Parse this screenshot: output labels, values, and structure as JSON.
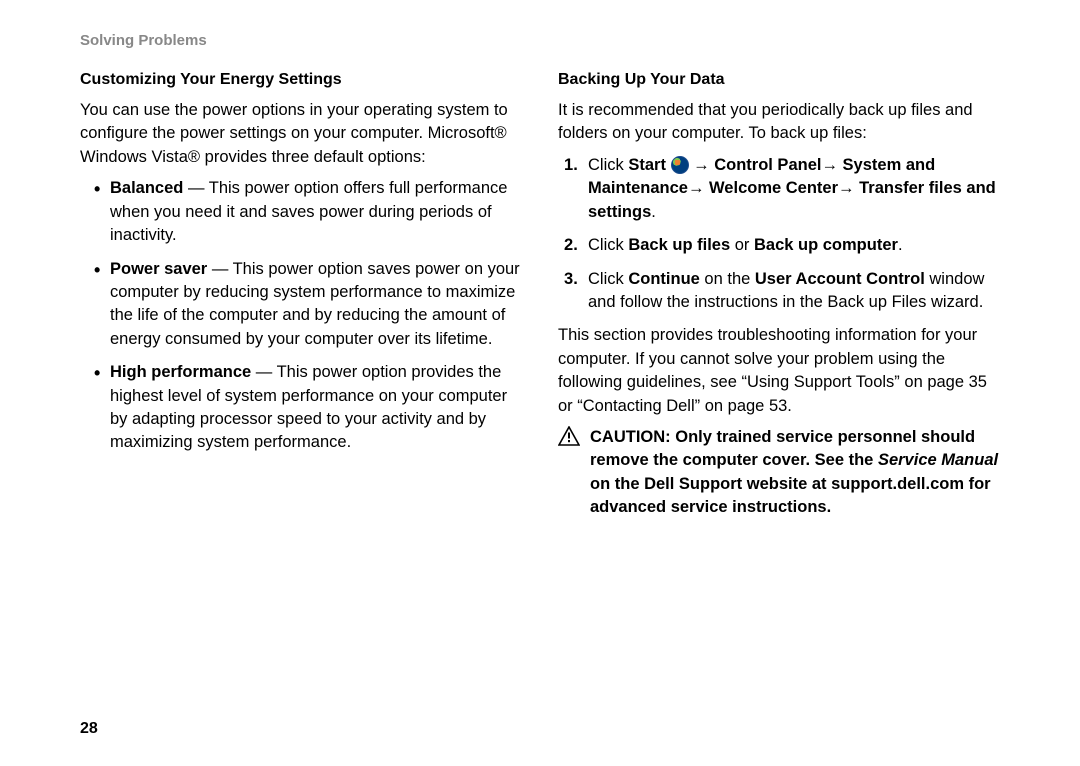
{
  "header": "Solving Problems",
  "pageNumber": "28",
  "left": {
    "heading": "Customizing Your Energy Settings",
    "intro": "You can use the power options in your operating system to configure the power settings on your computer. Microsoft® Windows Vista® provides three default options:",
    "bullets": [
      {
        "label": "Balanced",
        "text": " — This power option offers full performance when you need it and saves power during periods of inactivity."
      },
      {
        "label": "Power saver",
        "text": " — This power option saves power on your computer by reducing system performance to maximize the life of the computer and by reducing the amount of energy consumed by your computer over its lifetime."
      },
      {
        "label": "High performance",
        "text": " — This power option provides the highest level of system performance on your computer by adapting processor speed to your activity and by maximizing system performance."
      }
    ]
  },
  "right": {
    "heading": "Backing Up Your Data",
    "intro": "It is recommended that you periodically back up files and folders on your computer. To back up files:",
    "steps": {
      "s1": {
        "pre": "Click ",
        "start": "Start ",
        "path": " → Control Panel→ System and Maintenance→ Welcome Center→ Transfer files and settings",
        "post": "."
      },
      "s2": {
        "pre": "Click ",
        "b1": "Back up files",
        "mid": " or ",
        "b2": "Back up computer",
        "post": "."
      },
      "s3": {
        "pre": "Click ",
        "b1": "Continue",
        "mid": " on the ",
        "b2": "User Account Control",
        "post": " window and follow the instructions in the Back up Files wizard."
      }
    },
    "troubleshoot": "This section provides troubleshooting information for your computer. If you cannot solve your problem using the following guidelines, see “Using Support Tools” on page 35 or “Contacting Dell” on page 53.",
    "caution": {
      "t1": "CAUTION: Only trained service personnel should remove the computer cover. See the ",
      "manual": "Service Manual",
      "t2": " on the Dell Support website at support.dell.com for advanced service instructions."
    }
  }
}
